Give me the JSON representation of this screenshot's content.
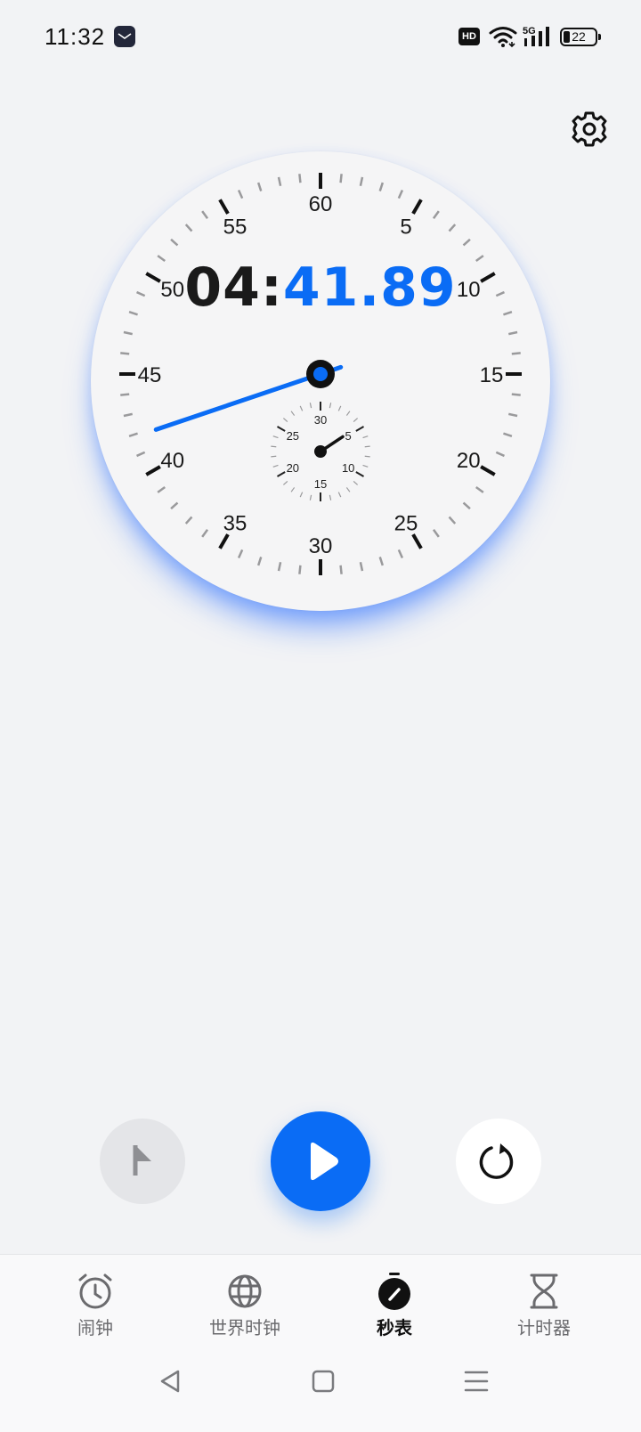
{
  "status_bar": {
    "time": "11:32",
    "hd_label": "HD",
    "network_label": "5G",
    "battery_percent": "22",
    "battery_level": 0.22
  },
  "stopwatch": {
    "elapsed_minutes": "04",
    "separator": ":",
    "elapsed_seconds": "41.89",
    "dial_labels": [
      "60",
      "5",
      "10",
      "15",
      "20",
      "25",
      "30",
      "35",
      "40",
      "45",
      "50",
      "55"
    ],
    "subdial_labels": [
      "30",
      "5",
      "10",
      "15",
      "20",
      "25"
    ],
    "second_hand_seconds": 41.89,
    "minute_hand_minutes": 4.7
  },
  "controls": {
    "lap": "flag-icon",
    "start": "play-icon",
    "reset": "reset-icon"
  },
  "tabs": [
    {
      "label": "闹钟",
      "icon": "alarm-clock-icon",
      "active": false
    },
    {
      "label": "世界时钟",
      "icon": "globe-icon",
      "active": false
    },
    {
      "label": "秒表",
      "icon": "stopwatch-icon",
      "active": true
    },
    {
      "label": "计时器",
      "icon": "hourglass-icon",
      "active": false
    }
  ],
  "colors": {
    "accent": "#0a6cf5",
    "background": "#f2f3f5",
    "dial_face": "#f5f5f6"
  }
}
